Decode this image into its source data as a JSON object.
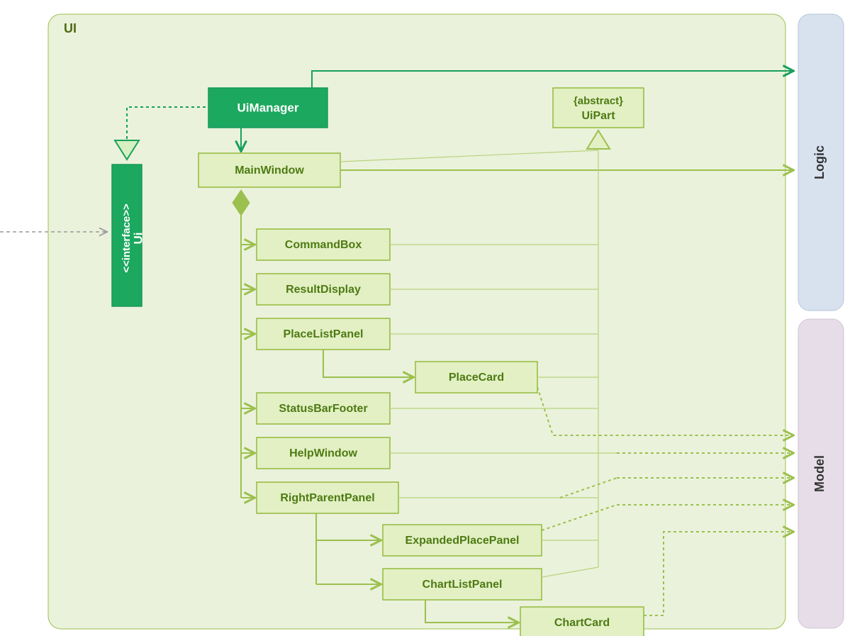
{
  "package": {
    "label": "UI"
  },
  "interface": {
    "stereotype": "<<interface>>",
    "name": "Ui"
  },
  "uiManager": "UiManager",
  "uiPart": {
    "stereotype": "{abstract}",
    "name": "UiPart"
  },
  "mainWindow": "MainWindow",
  "children": {
    "commandBox": "CommandBox",
    "resultDisplay": "ResultDisplay",
    "placeListPanel": "PlaceListPanel",
    "placeCard": "PlaceCard",
    "statusBarFooter": "StatusBarFooter",
    "helpWindow": "HelpWindow",
    "rightParentPanel": "RightParentPanel",
    "expandedPlacePanel": "ExpandedPlacePanel",
    "chartListPanel": "ChartListPanel",
    "chartCard": "ChartCard"
  },
  "external": {
    "logic": "Logic",
    "model": "Model"
  }
}
